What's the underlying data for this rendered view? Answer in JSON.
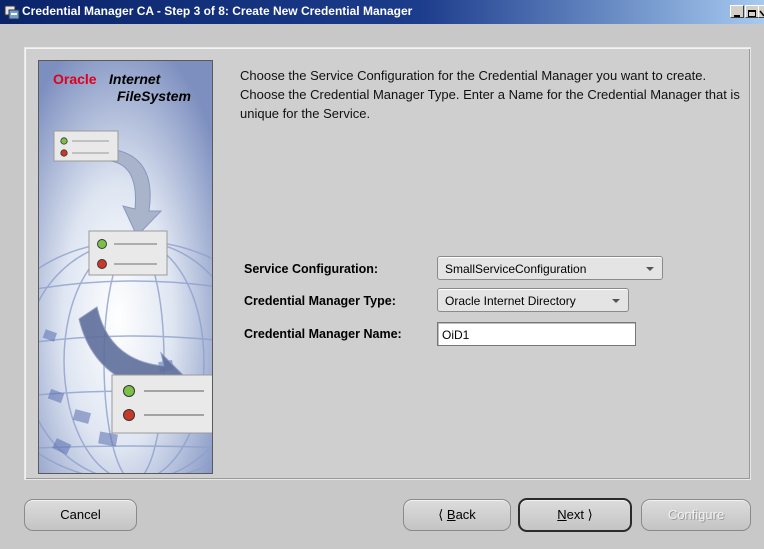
{
  "window": {
    "title": "Credential Manager CA - Step 3 of 8: Create New Credential Manager"
  },
  "branding": {
    "oracle": "Oracle",
    "internet": "Internet",
    "filesystem": "FileSystem"
  },
  "instructions": "Choose the Service Configuration for the Credential Manager you want to create. Choose the Credential Manager Type. Enter a Name for the Credential Manager that is unique for the Service.",
  "form": {
    "service_configuration": {
      "label": "Service Configuration:",
      "value": "SmallServiceConfiguration"
    },
    "credential_manager_type": {
      "label": "Credential Manager Type:",
      "value": "Oracle Internet Directory"
    },
    "credential_manager_name": {
      "label": "Credential Manager Name:",
      "value": "OiD1"
    }
  },
  "buttons": {
    "cancel": "Cancel",
    "back_accel": "B",
    "back_rest": "ack",
    "next_accel": "N",
    "next_rest": "ext",
    "configure": "Configure"
  },
  "icons": {
    "back": "chevron-left-icon",
    "next": "chevron-right-icon"
  },
  "colors": {
    "title_bar": "#0a246a",
    "oracle_red": "#e0001c",
    "disabled_text": "#f2f2f2"
  }
}
